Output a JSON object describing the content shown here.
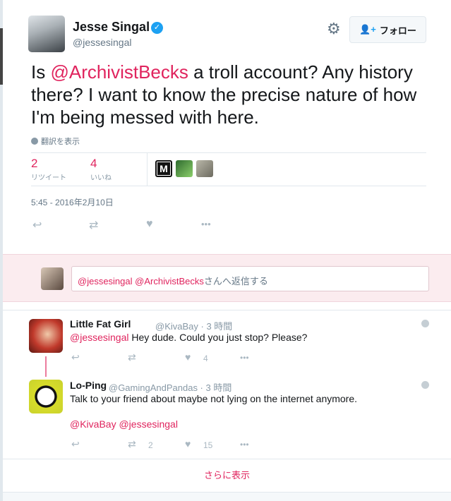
{
  "tweet": {
    "author_name": "Jesse Singal",
    "author_handle": "@jessesingal",
    "verified_glyph": "✓",
    "follow_label": "フォロー",
    "text_before": "Is ",
    "text_mention": "@ArchivistBecks",
    "text_after": " a troll account? Any history there? I want to know the precise nature of how I'm being messed with here.",
    "translate_label": "翻訳を表示",
    "retweets_count": "2",
    "retweets_label": "リツイート",
    "likes_count": "4",
    "likes_label": "いいね",
    "liker_badge": "M",
    "timestamp": "5:45 - 2016年2月10日"
  },
  "reply_box": {
    "mention_1": "@jessesingal",
    "mention_2": "@ArchivistBecks",
    "suffix": "さんへ返信する"
  },
  "replies": [
    {
      "name": "Little Fat Girl",
      "handle": "@KivaBay",
      "time": "3 時間",
      "mention": "@jessesingal",
      "text": " Hey dude. Could you just stop? Please?",
      "likes": "4"
    },
    {
      "name": "Lo-Ping",
      "handle": "@GamingAndPandas",
      "time": "3 時間",
      "text": "Talk to your friend about maybe not lying on the internet anymore.",
      "mention_1": "@KivaBay",
      "mention_2": "@jessesingal",
      "retweets": "2",
      "likes": "15"
    }
  ],
  "show_more_label": "さらに表示",
  "icons": {
    "reply": "↩",
    "retweet": "⇄",
    "like": "♥",
    "more": "•••",
    "gear": "⚙",
    "person_add": "👤+"
  },
  "colors": {
    "accent": "#e0245e",
    "verified": "#1da1f2",
    "muted": "#657786"
  },
  "middot": " · "
}
